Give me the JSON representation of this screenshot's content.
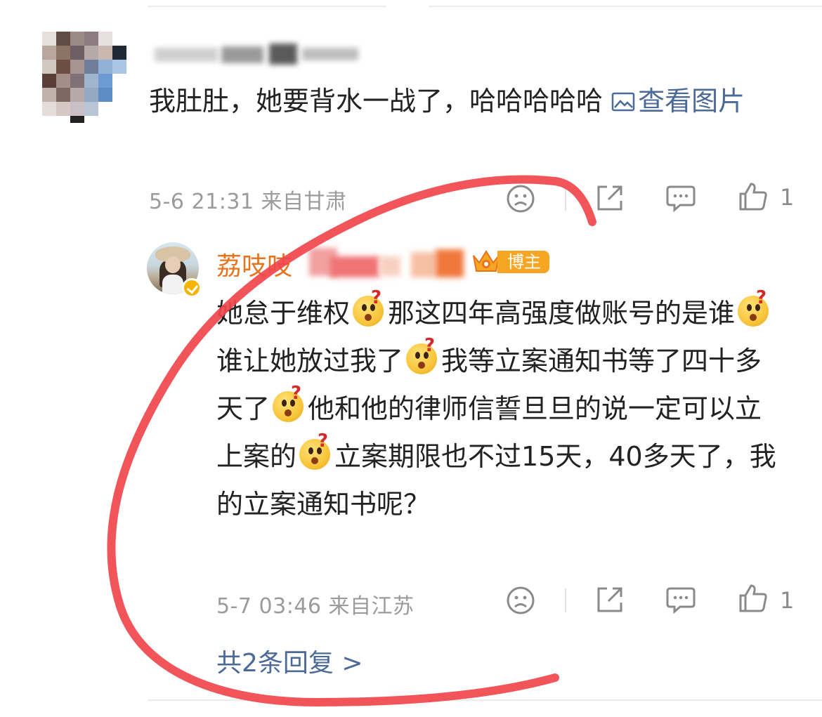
{
  "comment": {
    "text": "我肚肚，她要背水一战了，哈哈哈哈哈",
    "view_image_label": "查看",
    "view_image_label2": "图片",
    "meta": "5-6 21:31 来自甘肃",
    "like_count": "1"
  },
  "reply": {
    "name": "荔吱吱",
    "badge_label": "博主",
    "text_segments": [
      "她怠于维权",
      "那这四年高强度做账号的是谁",
      "谁让她放过我了",
      "我等立案通知书等了四十多天了",
      "他和他的律师信誓旦旦的说一定可以立上案的",
      "立案期限也不过15天，40多天了，我的立案通知书呢？"
    ],
    "meta": "5-7 03:46 来自江苏",
    "like_count": "1"
  },
  "more_replies_label": "共2条回复 >",
  "icons": {
    "emoji": "thinking-question-emoji",
    "view_image": "image-icon",
    "dislike": "sad-face-icon",
    "share": "share-icon",
    "comment": "comment-icon",
    "like": "thumbs-up-icon",
    "verified": "verified-badge-icon",
    "crown": "crown-icon"
  },
  "colors": {
    "link": "#4b6a97",
    "name": "#e8731c",
    "badge": "#f6a623",
    "scribble": "#f0474c"
  }
}
